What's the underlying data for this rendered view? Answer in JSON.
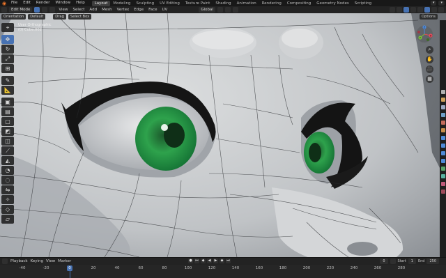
{
  "topbar": {
    "menus": [
      "File",
      "Edit",
      "Render",
      "Window",
      "Help"
    ],
    "workspaces": [
      "Layout",
      "Modeling",
      "Sculpting",
      "UV Editing",
      "Texture Paint",
      "Shading",
      "Animation",
      "Rendering",
      "Compositing",
      "Geometry Nodes",
      "Scripting"
    ],
    "active_workspace": "Layout"
  },
  "header": {
    "mode": "Edit Mode",
    "menus": [
      "View",
      "Select",
      "Add",
      "Mesh",
      "Vertex",
      "Edge",
      "Face",
      "UV"
    ],
    "transform_orientation": "Global"
  },
  "toolrow": {
    "orientation_label": "Orientation",
    "orientation_value": "Default",
    "drag_label": "Drag",
    "drag_value": "Select Box",
    "options_label": "Options"
  },
  "viewport": {
    "view_name": "User Orthographic",
    "object_name": "(0) Cube.002"
  },
  "lefttools": [
    "cursor-icon",
    "move-icon",
    "rotate-icon",
    "scale-icon",
    "transform-icon",
    "annotate-icon",
    "measure-icon",
    "add-cube-icon",
    "extrude-icon",
    "inset-icon",
    "bevel-icon",
    "loopcut-icon",
    "knife-icon",
    "polybuild-icon",
    "spin-icon",
    "smooth-icon",
    "edge-slide-icon",
    "shrink-icon",
    "shear-icon",
    "rip-icon"
  ],
  "gizmo": {
    "x": "X",
    "y": "Y",
    "z": "Z"
  },
  "timeline": {
    "menus": [
      "Playback",
      "Keying",
      "View",
      "Marker"
    ],
    "current_frame": "0",
    "start_label": "Start",
    "start_value": "1",
    "end_label": "End",
    "end_value": "250",
    "ticks": [
      "-40",
      "-20",
      "0",
      "20",
      "40",
      "60",
      "80",
      "100",
      "120",
      "140",
      "160",
      "180",
      "200",
      "220",
      "240",
      "260",
      "280"
    ]
  },
  "colors": {
    "accent": "#4772b3",
    "eye_green": "#2a9a48",
    "mesh_surface": "#b9bcc0"
  }
}
